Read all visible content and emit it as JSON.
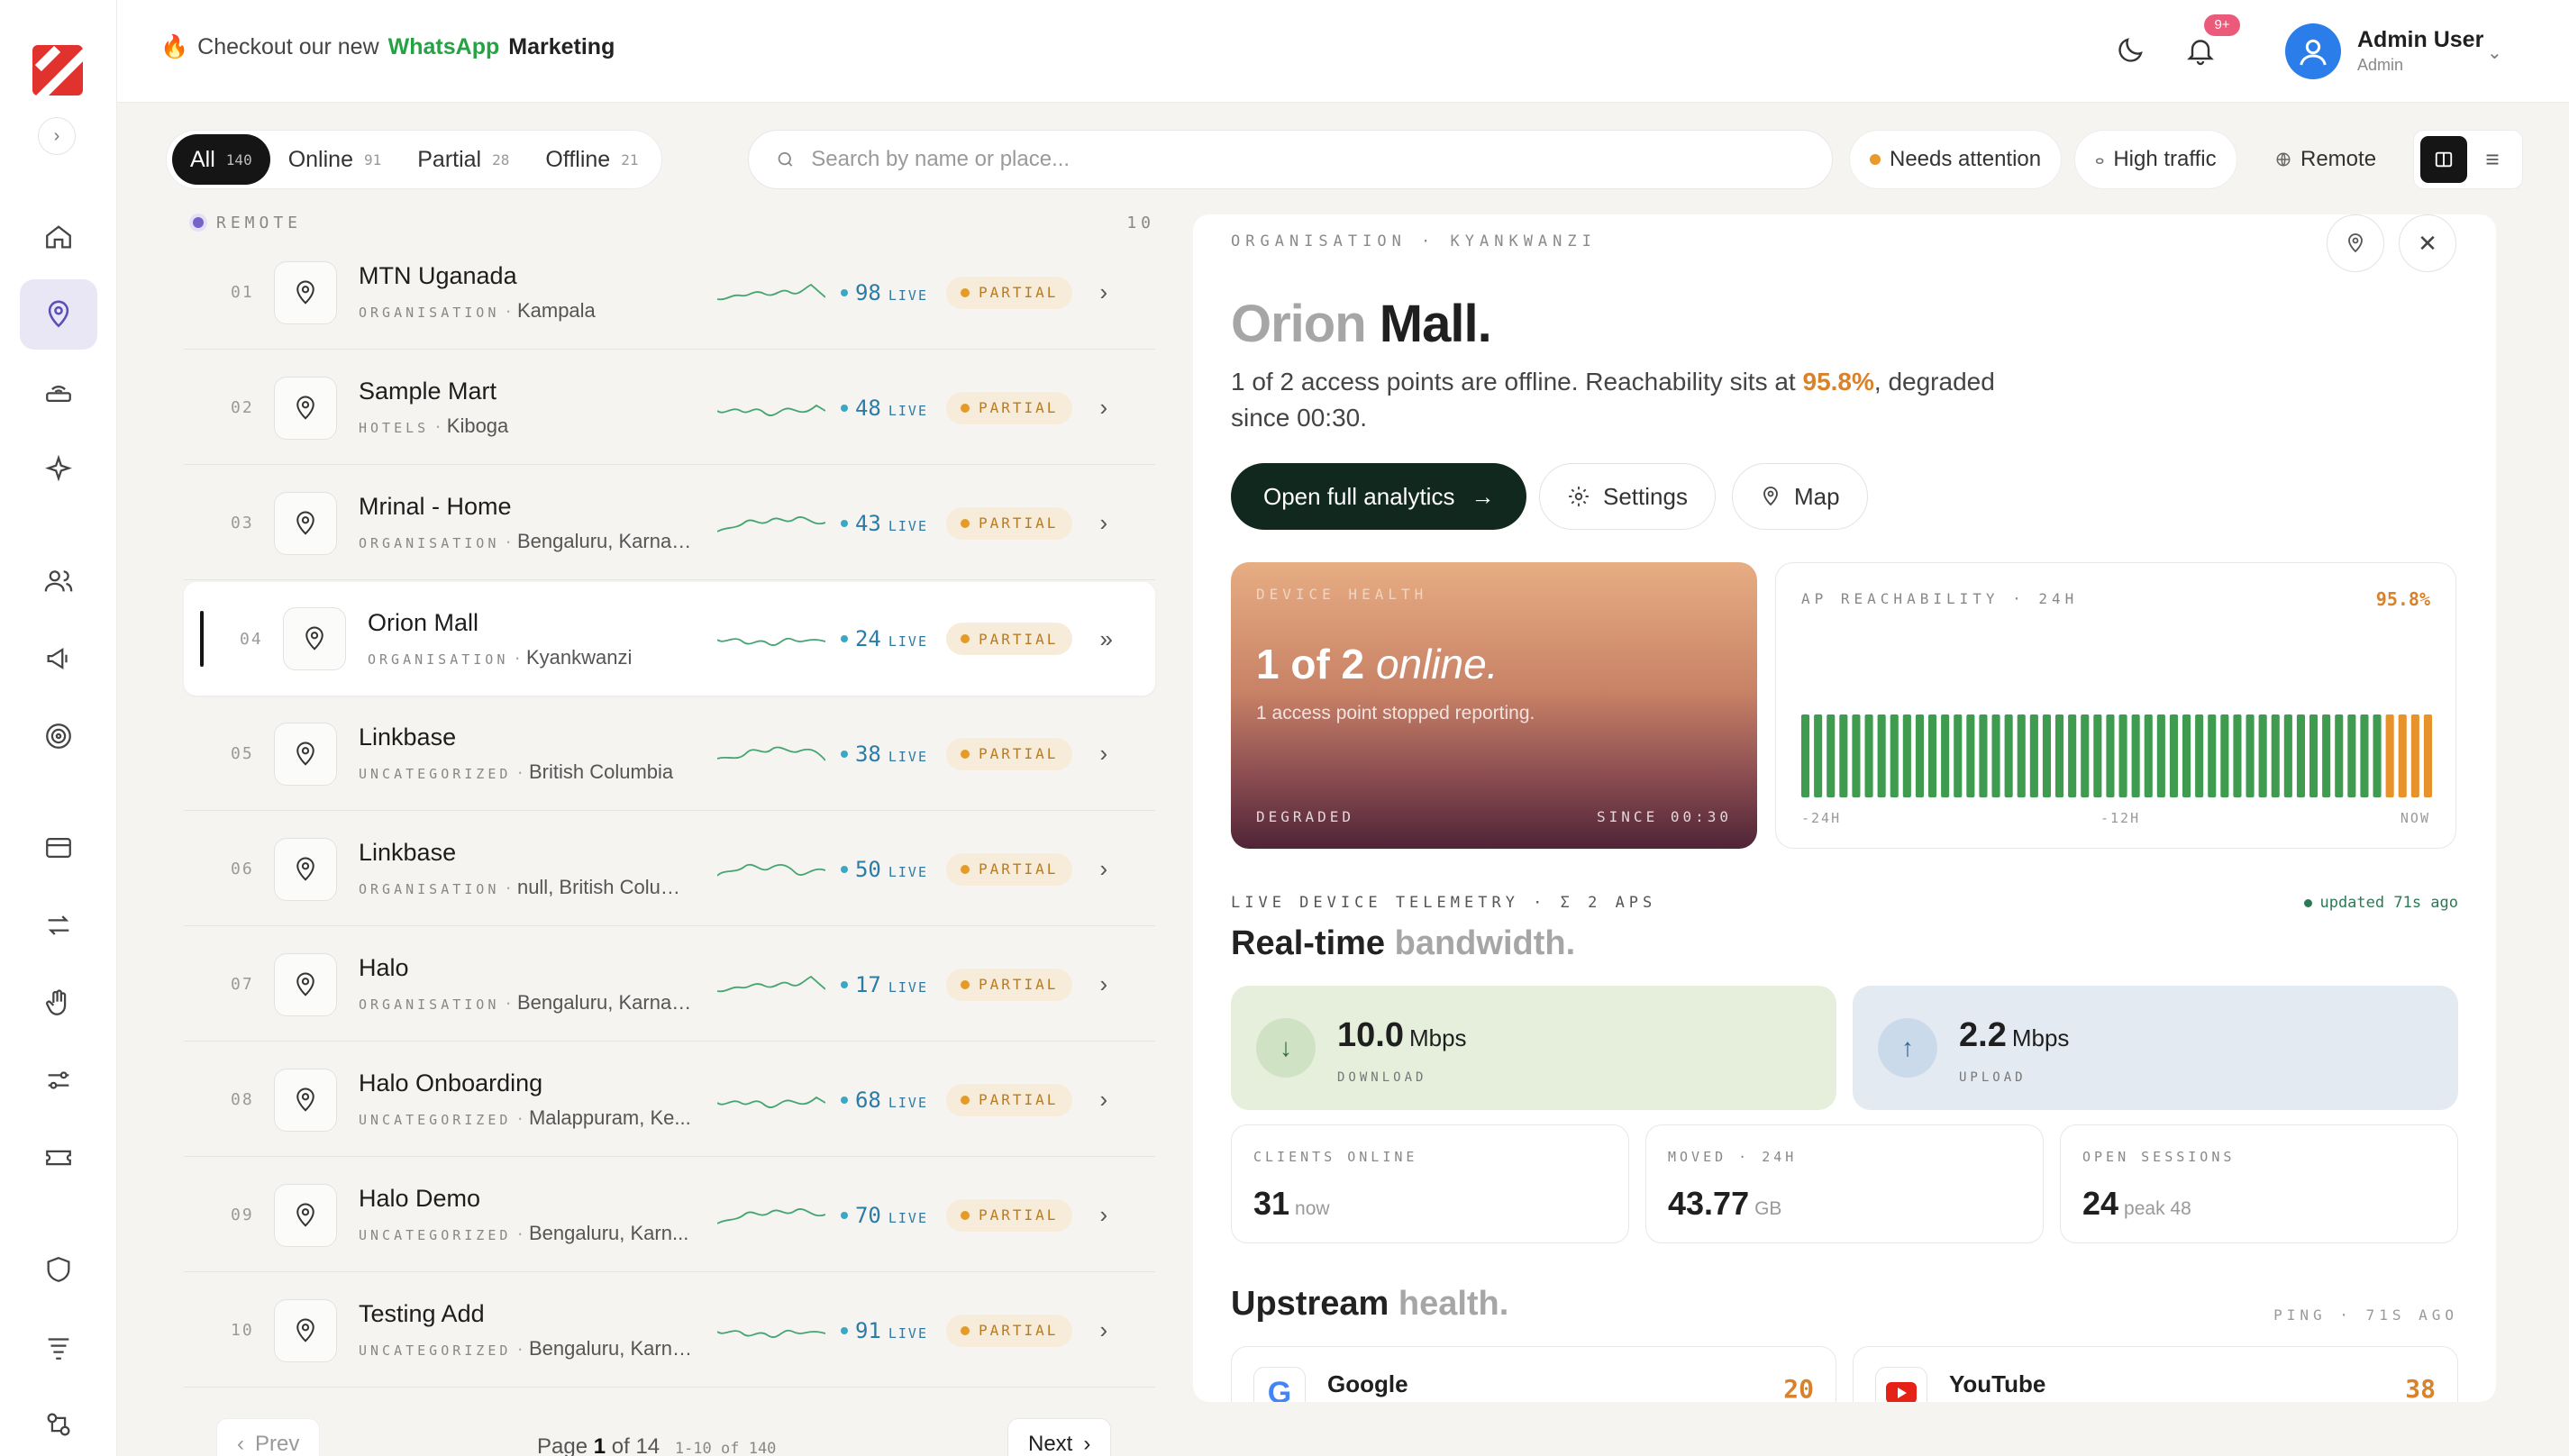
{
  "topbar": {
    "promo_prefix": "Checkout our new",
    "promo_whatsapp": "WhatsApp",
    "promo_marketing": "Marketing",
    "notif_badge": "9+",
    "user_name": "Admin User",
    "user_role": "Admin"
  },
  "filters": {
    "tabs": [
      {
        "label": "All",
        "count": "140"
      },
      {
        "label": "Online",
        "count": "91"
      },
      {
        "label": "Partial",
        "count": "28"
      },
      {
        "label": "Offline",
        "count": "21"
      }
    ],
    "search_placeholder": "Search by name or place...",
    "chips": [
      "Needs attention",
      "High traffic",
      "Remote"
    ]
  },
  "list": {
    "group_label": "REMOTE",
    "group_count": "10",
    "rows": [
      {
        "num": "01",
        "name": "MTN Uganada",
        "category": "ORGANISATION",
        "place": "Kampala",
        "live": "98",
        "status": "PARTIAL"
      },
      {
        "num": "02",
        "name": "Sample Mart",
        "category": "HOTELS",
        "place": "Kiboga",
        "live": "48",
        "status": "PARTIAL"
      },
      {
        "num": "03",
        "name": "Mrinal - Home",
        "category": "ORGANISATION",
        "place": "Bengaluru, Karnat...",
        "live": "43",
        "status": "PARTIAL"
      },
      {
        "num": "04",
        "name": "Orion Mall",
        "category": "ORGANISATION",
        "place": "Kyankwanzi",
        "live": "24",
        "status": "PARTIAL"
      },
      {
        "num": "05",
        "name": "Linkbase",
        "category": "UNCATEGORIZED",
        "place": "British Columbia",
        "live": "38",
        "status": "PARTIAL"
      },
      {
        "num": "06",
        "name": "Linkbase",
        "category": "ORGANISATION",
        "place": "null, British Colum...",
        "live": "50",
        "status": "PARTIAL"
      },
      {
        "num": "07",
        "name": "Halo",
        "category": "ORGANISATION",
        "place": "Bengaluru, Karnat...",
        "live": "17",
        "status": "PARTIAL"
      },
      {
        "num": "08",
        "name": "Halo Onboarding",
        "category": "UNCATEGORIZED",
        "place": "Malappuram, Ke...",
        "live": "68",
        "status": "PARTIAL"
      },
      {
        "num": "09",
        "name": "Halo Demo",
        "category": "UNCATEGORIZED",
        "place": "Bengaluru, Karn...",
        "live": "70",
        "status": "PARTIAL"
      },
      {
        "num": "10",
        "name": "Testing Add",
        "category": "UNCATEGORIZED",
        "place": "Bengaluru, Karna...",
        "live": "91",
        "status": "PARTIAL"
      }
    ],
    "live_label": "LIVE",
    "selected_index": 3
  },
  "pager": {
    "prev": "Prev",
    "next": "Next",
    "page_word": "Page",
    "page": "1",
    "of_word": "of",
    "total": "14",
    "range": "1-10 of 140"
  },
  "detail": {
    "crumb": "ORGANISATION · KYANKWANZI",
    "title_a": "Orion",
    "title_b": "Mall.",
    "desc_a": "1 of 2 access points are offline. Reachability sits at",
    "desc_pct": "95.8%",
    "desc_b": ", degraded since 00:30.",
    "btn_analytics": "Open full analytics",
    "btn_settings": "Settings",
    "btn_map": "Map",
    "health": {
      "label": "DEVICE HEALTH",
      "big_a": "1 of 2",
      "big_b": "online.",
      "sub": "1 access point stopped reporting.",
      "foot_left": "DEGRADED",
      "foot_right": "SINCE 00:30"
    },
    "reach": {
      "label": "AP REACHABILITY · 24H",
      "pct": "95.8%",
      "ax_left": "-24H",
      "ax_mid": "-12H",
      "ax_right": "NOW",
      "bars_ok": 46,
      "bars_degraded": 4,
      "color_ok": "#3e9b4f",
      "color_degraded": "#e8922b"
    },
    "telemetry_label": "LIVE DEVICE TELEMETRY · Σ 2 APS",
    "updated": "updated 71s ago",
    "bw_title_a": "Real-time",
    "bw_title_b": "bandwidth.",
    "download": {
      "value": "10.0",
      "unit": "Mbps",
      "label": "DOWNLOAD"
    },
    "upload": {
      "value": "2.2",
      "unit": "Mbps",
      "label": "UPLOAD"
    },
    "stats": [
      {
        "label": "CLIENTS ONLINE",
        "value": "31",
        "suffix": "now"
      },
      {
        "label": "MOVED · 24H",
        "value": "43.77",
        "suffix": "GB"
      },
      {
        "label": "OPEN SESSIONS",
        "value": "24",
        "suffix": "peak 48"
      }
    ],
    "up_title_a": "Upstream",
    "up_title_b": "health.",
    "ping_label": "PING · 71S AGO",
    "upstreams": [
      {
        "name": "Google",
        "ms": "20"
      },
      {
        "name": "YouTube",
        "ms": "38"
      }
    ]
  }
}
